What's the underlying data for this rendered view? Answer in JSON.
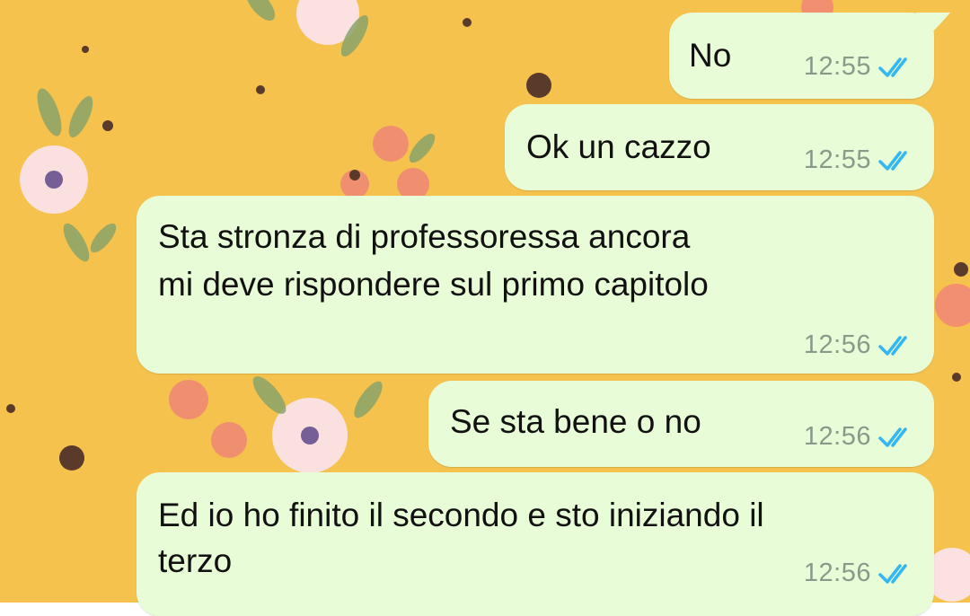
{
  "colors": {
    "wallpaper": "#f5c24d",
    "bubble_outgoing": "#e7fcd7",
    "read_ticks": "#34b7f1",
    "timestamp": "#8a9a8a"
  },
  "messages": [
    {
      "text": "No",
      "time": "12:55",
      "status": "read",
      "status_icon": "double-check-icon"
    },
    {
      "text": "Ok un cazzo",
      "time": "12:55",
      "status": "read",
      "status_icon": "double-check-icon"
    },
    {
      "lines": [
        "Sta stronza di professoressa ancora",
        "mi deve rispondere sul primo capitolo"
      ],
      "time": "12:56",
      "status": "read",
      "status_icon": "double-check-icon"
    },
    {
      "text": "Se sta bene o no",
      "time": "12:56",
      "status": "read",
      "status_icon": "double-check-icon"
    },
    {
      "lines": [
        "Ed io ho finito il secondo e sto iniziando il",
        "terzo"
      ],
      "time": "12:56",
      "status": "read",
      "status_icon": "double-check-icon"
    }
  ]
}
